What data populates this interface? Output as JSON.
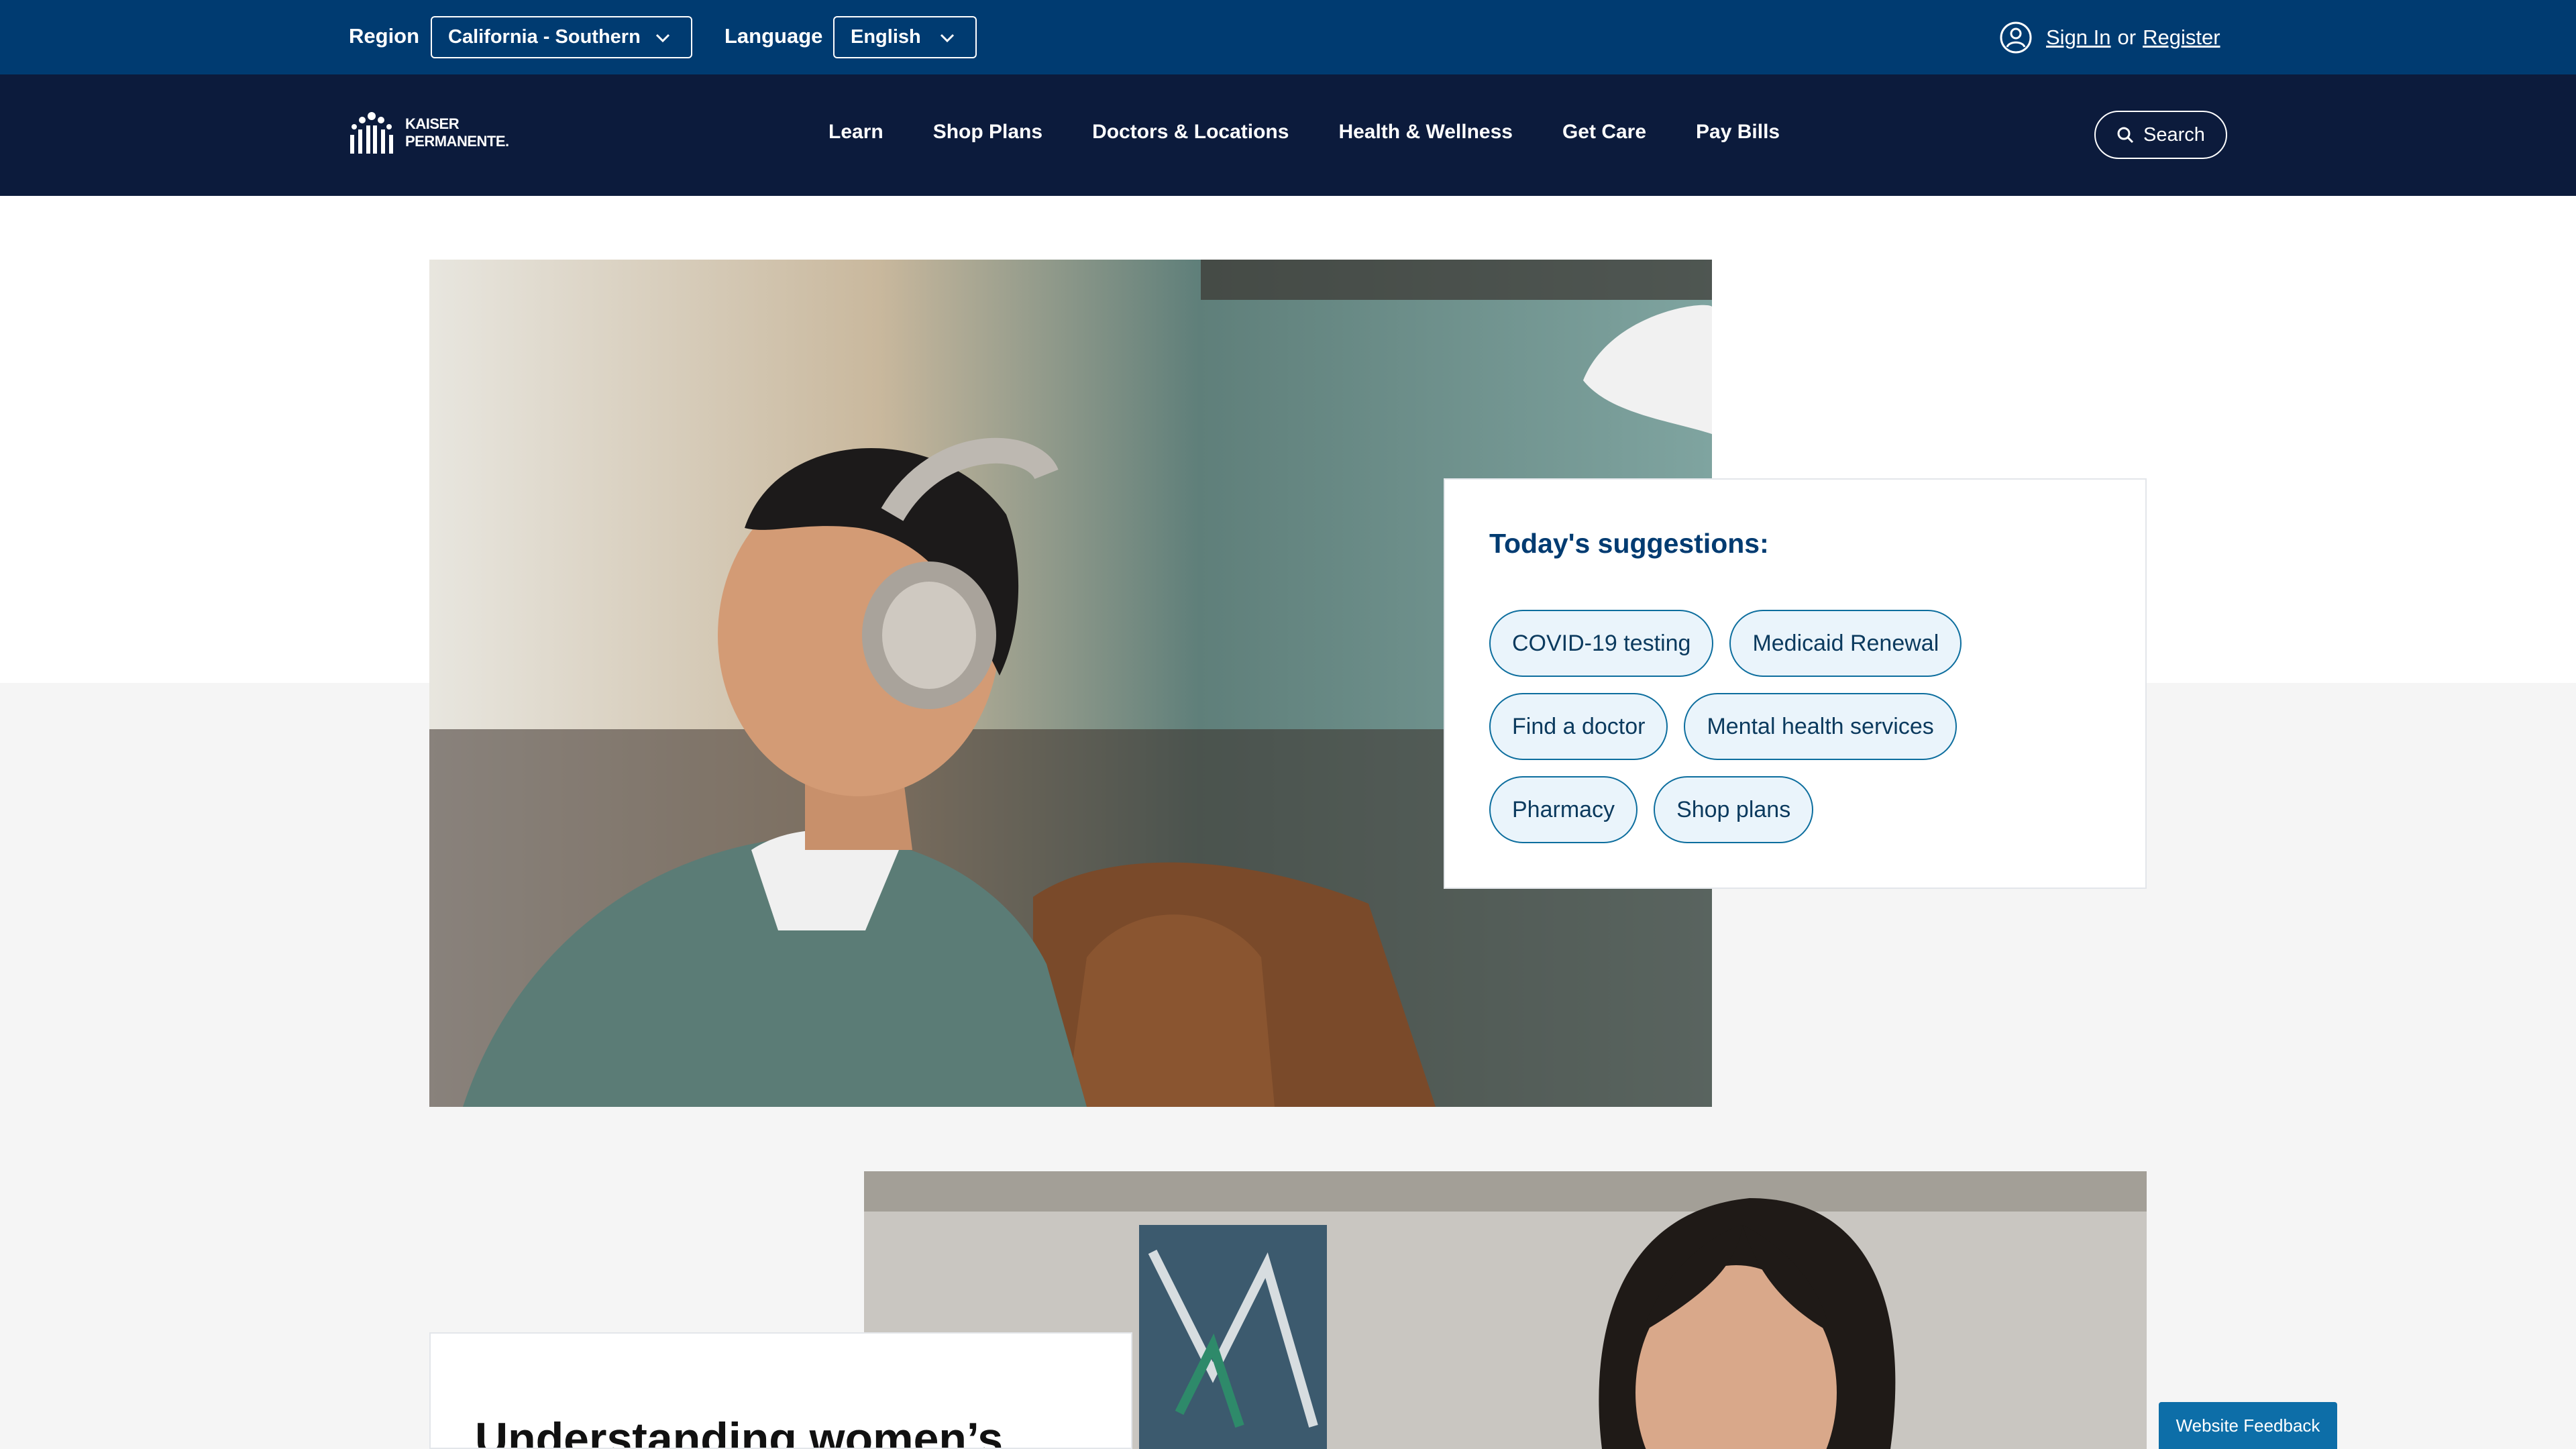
{
  "utility_bar": {
    "region_label": "Region",
    "region_value": "California - Southern",
    "language_label": "Language",
    "language_value": "English",
    "sign_in": "Sign In",
    "or": "or",
    "register": "Register"
  },
  "nav": {
    "logo_line1": "KAISER",
    "logo_line2": "PERMANENTE.",
    "items": [
      "Learn",
      "Shop Plans",
      "Doctors & Locations",
      "Health & Wellness",
      "Get Care",
      "Pay Bills"
    ],
    "search_label": "Search"
  },
  "suggestions": {
    "title": "Today's suggestions:",
    "chips": [
      "COVID-19 testing",
      "Medicaid Renewal",
      "Find a doctor",
      "Mental health services",
      "Pharmacy",
      "Shop plans"
    ]
  },
  "article": {
    "title": "Understanding women’s"
  },
  "feedback": {
    "label": "Website Feedback"
  },
  "colors": {
    "utility_bar": "#003b71",
    "nav_bar": "#0c1b3c",
    "chip_border": "#0d6e9e",
    "feedback": "#0d6ea8"
  }
}
